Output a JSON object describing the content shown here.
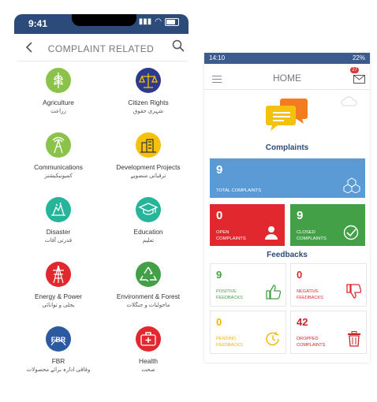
{
  "left_screen": {
    "status_time": "9:41",
    "title": "COMPLAINT RELATED",
    "back_icon": "chevron-left-icon",
    "search_icon": "search-icon",
    "categories": [
      {
        "name": "Agriculture",
        "urdu": "زراعت",
        "color": "#8bc34a",
        "icon": "wheat-icon"
      },
      {
        "name": "Citizen Rights",
        "urdu": "شہری حقوق",
        "color": "#2e3a8c",
        "icon": "scales-icon"
      },
      {
        "name": "Communications",
        "urdu": "کمیونیکیشنز",
        "color": "#8bc34a",
        "icon": "tower-icon"
      },
      {
        "name": "Development Projects",
        "urdu": "ترقیاتی منصوبے",
        "color": "#f4c20d",
        "icon": "buildings-icon"
      },
      {
        "name": "Disaster",
        "urdu": "قدرتی آفات",
        "color": "#26b59a",
        "icon": "disaster-icon"
      },
      {
        "name": "Education",
        "urdu": "تعلیم",
        "color": "#26b59a",
        "icon": "graduation-cap-icon"
      },
      {
        "name": "Energy & Power",
        "urdu": "بجلی و توانائی",
        "color": "#e0282e",
        "icon": "power-pylon-icon"
      },
      {
        "name": "Environment & Forest",
        "urdu": "ماحولیات و جنگلات",
        "color": "#43a047",
        "icon": "recycle-icon"
      },
      {
        "name": "FBR",
        "urdu": "وفاقی ادارہ برائے محصولات",
        "color": "#2c5aa0",
        "icon": "fbr-logo-icon"
      },
      {
        "name": "Health",
        "urdu": "صحت",
        "color": "#e0282e",
        "icon": "medical-kit-icon"
      }
    ]
  },
  "right_screen": {
    "status_time": "14:10",
    "status_right": "22%",
    "title": "HOME",
    "mail_badge": "27",
    "complaints_heading": "Complaints",
    "feedbacks_heading": "Feedbacks",
    "total": {
      "value": "9",
      "label": "TOTAL COMPLAINTS",
      "color": "#5b9bd5"
    },
    "open": {
      "value": "0",
      "label_1": "OPEN",
      "label_2": "COMPLAINTS",
      "color": "#e0282e"
    },
    "closed": {
      "value": "9",
      "label_1": "CLOSED",
      "label_2": "COMPLAINTS",
      "color": "#43a047"
    },
    "positive": {
      "value": "9",
      "label_1": "POSITIVE",
      "label_2": "FEEDBACKS",
      "color": "#43a047"
    },
    "negative": {
      "value": "0",
      "label_1": "NEGATIVE",
      "label_2": "FEEDBACKS",
      "color": "#e0282e"
    },
    "pending": {
      "value": "0",
      "label_1": "PENDING",
      "label_2": "FEEDBACKS",
      "color": "#f4b400"
    },
    "dropped": {
      "value": "42",
      "label_1": "DROPPED",
      "label_2": "COMPLAINTS",
      "color": "#c62828"
    }
  }
}
